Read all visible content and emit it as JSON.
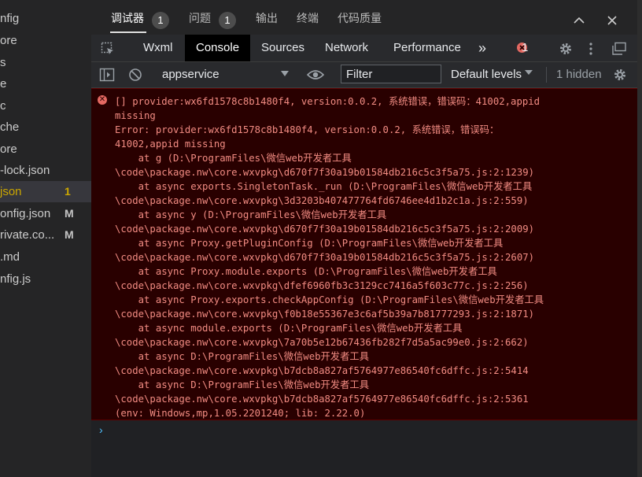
{
  "explorer": {
    "files": [
      {
        "name": "nfig",
        "badge": "",
        "state": ""
      },
      {
        "name": "ore",
        "badge": "",
        "state": ""
      },
      {
        "name": "s",
        "badge": "",
        "state": ""
      },
      {
        "name": "e",
        "badge": "",
        "state": ""
      },
      {
        "name": "c",
        "badge": "",
        "state": ""
      },
      {
        "name": "che",
        "badge": "",
        "state": ""
      },
      {
        "name": "ore",
        "badge": "",
        "state": ""
      },
      {
        "name": "-lock.json",
        "badge": "",
        "state": ""
      },
      {
        "name": "json",
        "badge": "1",
        "state": "warn"
      },
      {
        "name": "onfig.json",
        "badge": "M",
        "state": "mod"
      },
      {
        "name": "rivate.co...",
        "badge": "M",
        "state": "mod"
      },
      {
        "name": ".md",
        "badge": "",
        "state": ""
      },
      {
        "name": "nfig.js",
        "badge": "",
        "state": ""
      }
    ]
  },
  "top_tabs": {
    "debugger": "调试器",
    "debugger_count": "1",
    "problems": "问题",
    "problems_count": "1",
    "output": "输出",
    "terminal": "终端",
    "code_quality": "代码质量"
  },
  "devtools_tabs": {
    "wxml": "Wxml",
    "console": "Console",
    "sources": "Sources",
    "network": "Network",
    "performance": "Performance",
    "more": "»",
    "error_count": "1"
  },
  "toolbar": {
    "context": "appservice",
    "filter_placeholder": "Filter",
    "levels": "Default levels",
    "hidden": "1 hidden"
  },
  "console": {
    "error_text": "[] provider:wx6fd1578c8b1480f4, version:0.0.2, 系统错误，错误码：41002,appid\nmissing\nError: provider:wx6fd1578c8b1480f4, version:0.0.2, 系统错误，错误码：\n41002,appid missing\n    at g (D:\\ProgramFiles\\微信web开发者工具\n\\code\\package.nw\\core.wxvpkg\\d670f7f30a19b01584db216c5c3f5a75.js:2:1239)\n    at async exports.SingletonTask._run (D:\\ProgramFiles\\微信web开发者工具\n\\code\\package.nw\\core.wxvpkg\\3d3203b407477764fd6746ee4d1b2c1a.js:2:559)\n    at async y (D:\\ProgramFiles\\微信web开发者工具\n\\code\\package.nw\\core.wxvpkg\\d670f7f30a19b01584db216c5c3f5a75.js:2:2009)\n    at async Proxy.getPluginConfig (D:\\ProgramFiles\\微信web开发者工具\n\\code\\package.nw\\core.wxvpkg\\d670f7f30a19b01584db216c5c3f5a75.js:2:2607)\n    at async Proxy.module.exports (D:\\ProgramFiles\\微信web开发者工具\n\\code\\package.nw\\core.wxvpkg\\dfef6960fb3c3129cc7416a5f603c77c.js:2:256)\n    at async Proxy.exports.checkAppConfig (D:\\ProgramFiles\\微信web开发者工具\n\\code\\package.nw\\core.wxvpkg\\f0b18e55367e3c6af5b39a7b81777293.js:2:1871)\n    at async module.exports (D:\\ProgramFiles\\微信web开发者工具\n\\code\\package.nw\\core.wxvpkg\\7a70b5e12b67436fb282f7d5a5ac99e0.js:2:662)\n    at async D:\\ProgramFiles\\微信web开发者工具\n\\code\\package.nw\\core.wxvpkg\\b7dcb8a827af5764977e86540fc6dffc.js:2:5414\n    at async D:\\ProgramFiles\\微信web开发者工具\n\\code\\package.nw\\core.wxvpkg\\b7dcb8a827af5764977e86540fc6dffc.js:2:5361\n(env: Windows,mp,1.05.2201240; lib: 2.22.0)",
    "prompt": "›"
  },
  "colors": {
    "error_text": "#f28b82",
    "error_bg": "#290000",
    "warn_file": "#cca700",
    "prompt": "#4fc1ff"
  }
}
